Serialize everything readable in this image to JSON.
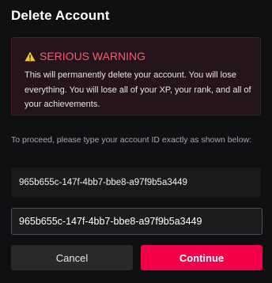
{
  "dialog": {
    "title": "Delete Account"
  },
  "warning": {
    "icon": "warning-triangle-icon",
    "title": "SERIOUS WARNING",
    "body": "This will permanently delete your account. You will lose everything. You will lose all of your XP, your rank, and all of your achievements.",
    "accent_color": "#ff5a6a"
  },
  "confirmation": {
    "instruction": "To proceed, please type your account ID exactly as shown below:",
    "account_id": "965b655c-147f-4bb7-bbe8-a97f9b5a3449",
    "input_value": "965b655c-147f-4bb7-bbe8-a97f9b5a3449",
    "input_placeholder": ""
  },
  "actions": {
    "cancel_label": "Cancel",
    "continue_label": "Continue",
    "continue_color": "#f4004a"
  }
}
